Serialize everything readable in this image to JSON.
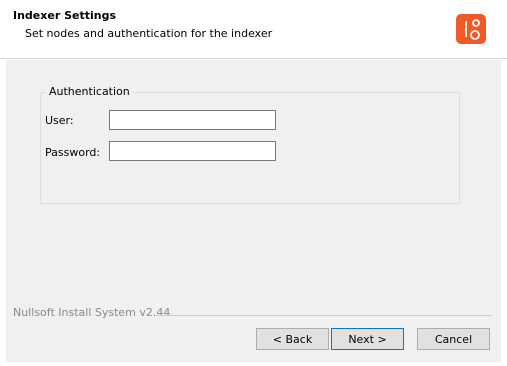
{
  "header": {
    "title": "Indexer Settings",
    "subtitle": "Set nodes and authentication for the indexer",
    "logo_icon": "installer-app-logo",
    "accent_color": "#f05a28"
  },
  "authentication": {
    "legend": "Authentication",
    "user_label": "User:",
    "user_value": "",
    "password_label": "Password:",
    "password_value": ""
  },
  "footer": {
    "branding": "Nullsoft Install System v2.44",
    "back_label": "< Back",
    "next_label": "Next >",
    "cancel_label": "Cancel"
  }
}
